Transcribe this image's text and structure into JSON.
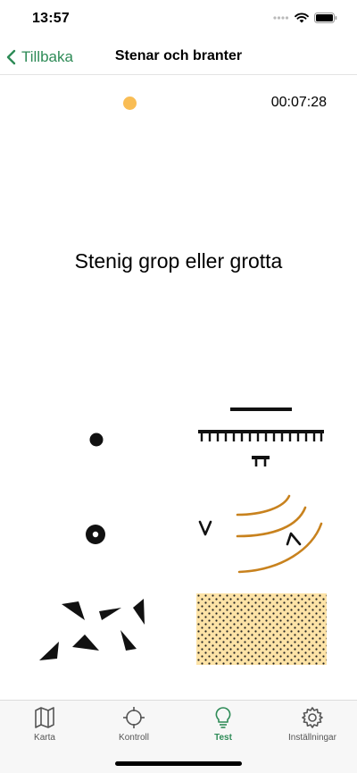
{
  "status_bar": {
    "time": "13:57"
  },
  "nav": {
    "back_label": "Tillbaka",
    "title": "Stenar och branter"
  },
  "quiz": {
    "timer": "00:07:28",
    "question": "Stenig grop eller grotta",
    "indicator_color": "#f9bd55"
  },
  "colors": {
    "accent": "#2e8b57",
    "contour": "#c8821e",
    "stony_ground_fill": "#fde3a7"
  },
  "tabs": [
    {
      "label": "Karta",
      "icon": "map-icon"
    },
    {
      "label": "Kontroll",
      "icon": "crosshair-icon"
    },
    {
      "label": "Test",
      "icon": "lightbulb-icon",
      "active": true
    },
    {
      "label": "Inställningar",
      "icon": "gear-icon"
    }
  ]
}
